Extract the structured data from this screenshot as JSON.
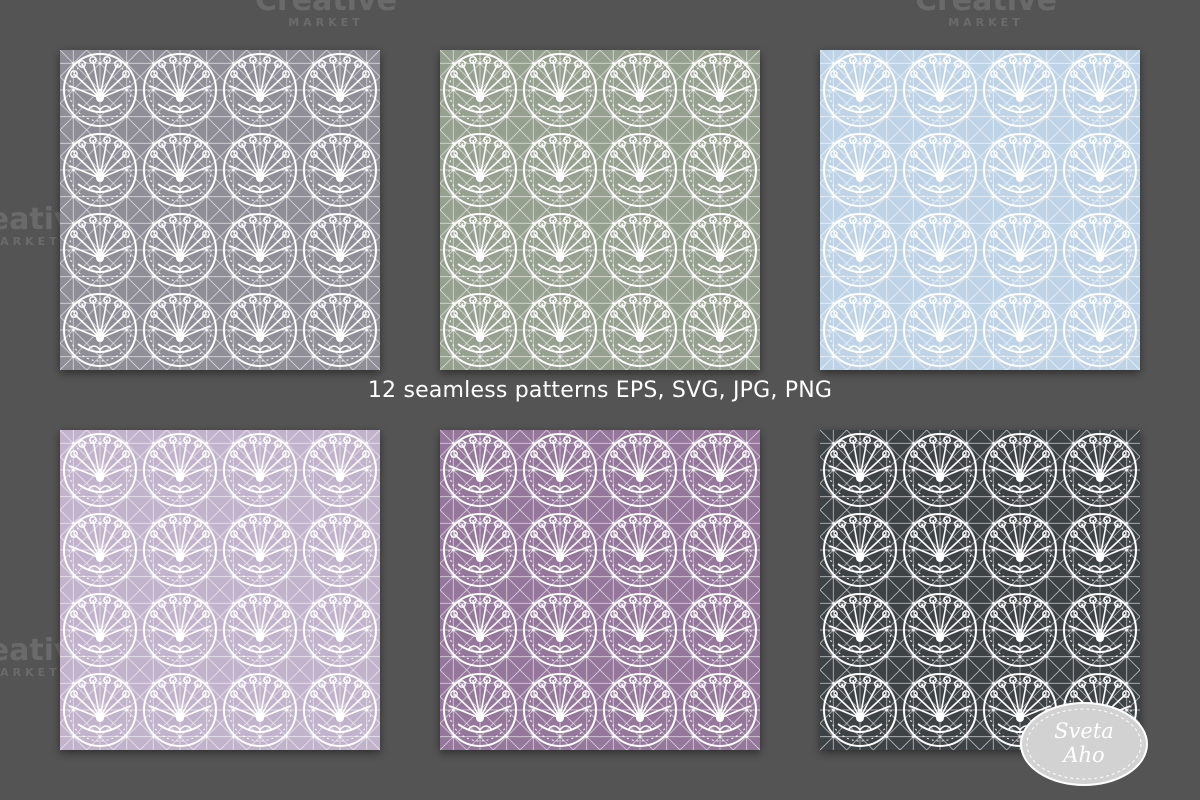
{
  "caption": "12 seamless patterns EPS, SVG, JPG, PNG",
  "watermark": {
    "brand": "Creative",
    "sub": "MARKET"
  },
  "logo": {
    "line1": "Sveta",
    "line2": "Aho"
  },
  "patterns": [
    {
      "name": "grey",
      "color": "#8f8e97"
    },
    {
      "name": "sage",
      "color": "#96a08f"
    },
    {
      "name": "light-blue",
      "color": "#bfd3e6"
    },
    {
      "name": "lavender",
      "color": "#c1b3cb"
    },
    {
      "name": "plum",
      "color": "#94779b"
    },
    {
      "name": "charcoal",
      "color": "#3d4245"
    }
  ],
  "colors": {
    "background": "#545454",
    "lace": "#ffffff"
  }
}
